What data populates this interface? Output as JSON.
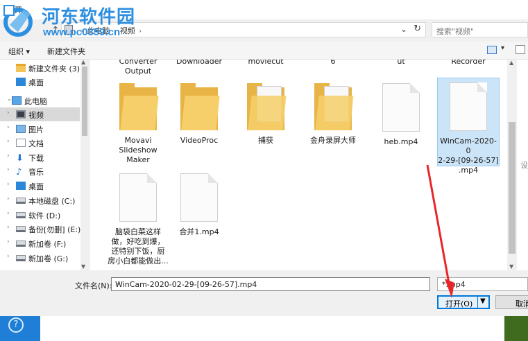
{
  "watermark": {
    "site_name": "河东软件园",
    "url": "www.pc0359.cn"
  },
  "window": {
    "title": "打开"
  },
  "address": {
    "crumbs": [
      "此电脑",
      "视频"
    ]
  },
  "search": {
    "placeholder": "搜索\"视频\""
  },
  "toolbar": {
    "organize": "组织 ▾",
    "new_folder": "新建文件夹"
  },
  "nav": {
    "items": [
      {
        "label": "新建文件夹 (3)",
        "icon": "folder-icon"
      },
      {
        "label": "桌面",
        "icon": "desktop-icon"
      },
      {
        "label": "此电脑",
        "icon": "pc-icon",
        "expanded": true
      },
      {
        "label": "视频",
        "icon": "video-icon",
        "selected": true
      },
      {
        "label": "图片",
        "icon": "picture-icon"
      },
      {
        "label": "文档",
        "icon": "document-icon"
      },
      {
        "label": "下载",
        "icon": "download-icon"
      },
      {
        "label": "音乐",
        "icon": "music-icon"
      },
      {
        "label": "桌面",
        "icon": "desktop-icon"
      },
      {
        "label": "本地磁盘 (C:)",
        "icon": "drive-icon"
      },
      {
        "label": "软件 (D:)",
        "icon": "drive-icon"
      },
      {
        "label": "备份[勿删] (E:)",
        "icon": "drive-icon"
      },
      {
        "label": "新加卷 (F:)",
        "icon": "drive-icon"
      },
      {
        "label": "新加卷 (G:)",
        "icon": "drive-icon"
      }
    ]
  },
  "top_partial_labels": [
    {
      "label": "Converter\nOutput"
    },
    {
      "label": "Downloader"
    },
    {
      "label": "moviecut"
    },
    {
      "label": "6"
    },
    {
      "label": "ut"
    },
    {
      "label": "Recorder"
    }
  ],
  "files": [
    {
      "name": "Movavi\nSlideshow\nMaker",
      "type": "folder"
    },
    {
      "name": "VideoProc",
      "type": "folder"
    },
    {
      "name": "捕获",
      "type": "folder-docs"
    },
    {
      "name": "金舟录屏大师",
      "type": "folder-docs"
    },
    {
      "name": "heb.mp4",
      "type": "file"
    },
    {
      "name": "WinCam-2020-0\n2-29-[09-26-57]\n.mp4",
      "type": "file",
      "selected": true
    },
    {
      "name": "脑袋白菜这样\n做，好吃到爆，\n还特别下饭，厨\n房小白都能做出...",
      "type": "file"
    },
    {
      "name": "合并1.mp4",
      "type": "file"
    }
  ],
  "right_partial": "设",
  "bottom": {
    "filename_label": "文件名(N):",
    "filename_value": "WinCam-2020-02-29-[09-26-57].mp4",
    "filetype_value": "*.mp4",
    "open_label": "打开(O)",
    "cancel_label": "取消"
  },
  "colors": {
    "accent": "#0078d7",
    "selection": "#cce4f7",
    "watermark": "#2d8fe0",
    "annotation_arrow": "#e8262a"
  }
}
